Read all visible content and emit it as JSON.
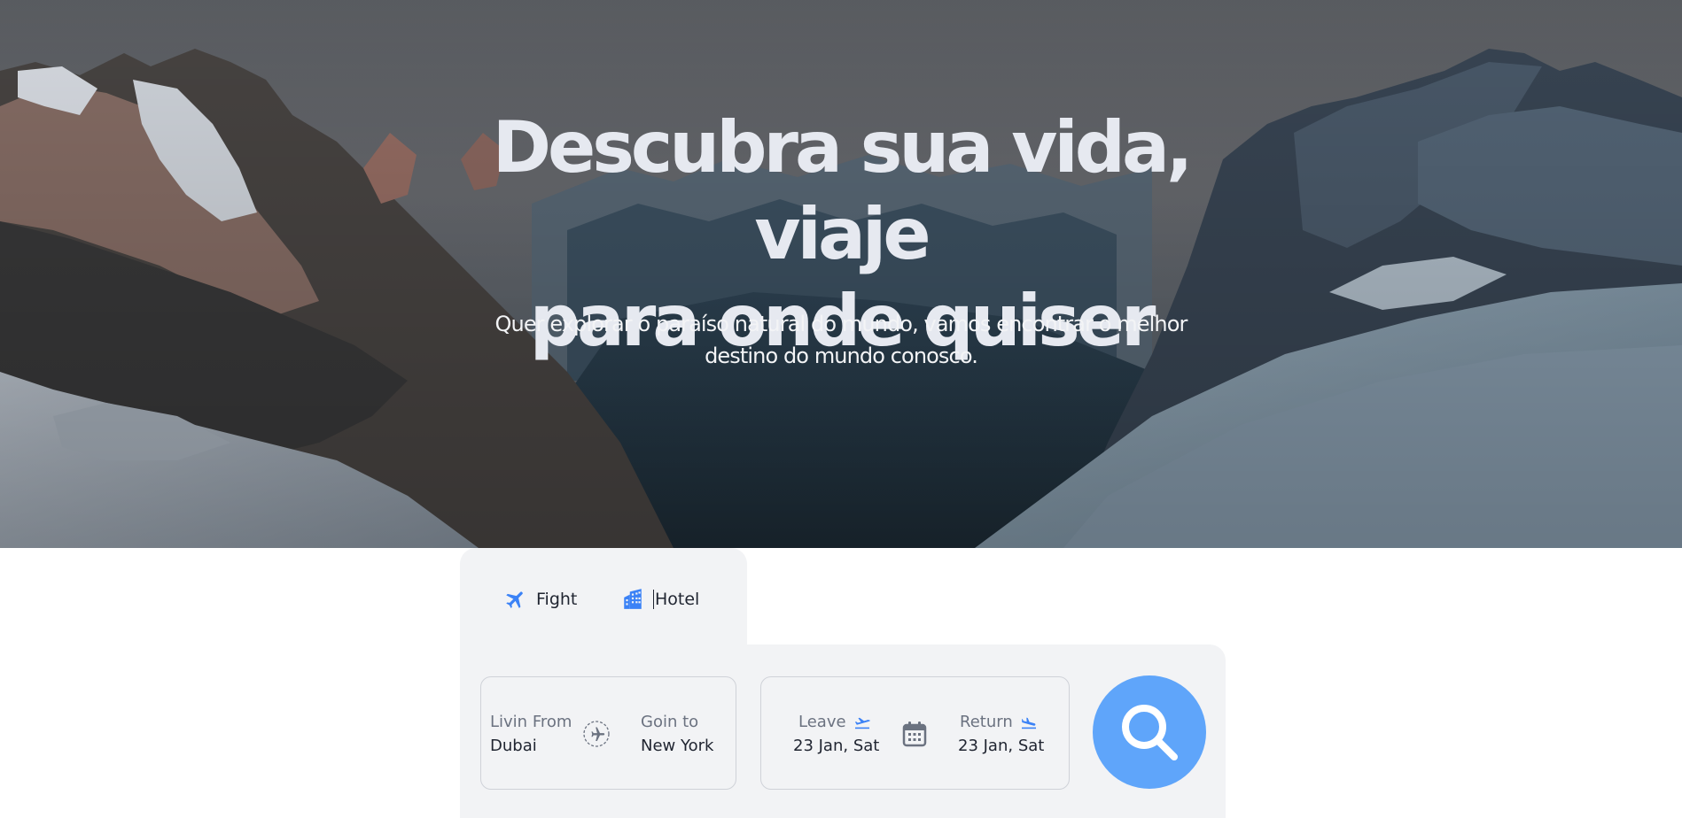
{
  "hero": {
    "title_line1": "Descubra sua vida, viaje",
    "title_line2": "para onde quiser",
    "subtitle_line1": "Quer explorar o paraíso natural do mundo, vamos encontrar o melhor",
    "subtitle_line2": "destino do mundo conosco."
  },
  "tabs": {
    "flight_label": "Fight",
    "hotel_label": "Hotel",
    "flight_icon": "plane-icon",
    "hotel_icon": "building-icon"
  },
  "search": {
    "from_label": "Livin From",
    "from_value": "Dubai",
    "to_label": "Goin to",
    "to_value": "New York",
    "leave_label": "Leave",
    "leave_value": "23 Jan, Sat",
    "return_label": "Return",
    "return_value": "23 Jan, Sat",
    "swap_icon": "plane-circle-icon",
    "calendar_icon": "calendar-icon",
    "search_icon": "magnifier-icon"
  },
  "colors": {
    "accent": "#5fa5fa",
    "icon_blue": "#3b82f6",
    "panel_bg": "#f2f3f5",
    "title_text": "#e6e9f0"
  }
}
